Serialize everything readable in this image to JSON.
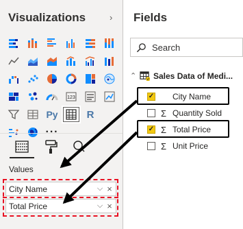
{
  "visualizations": {
    "title": "Visualizations",
    "tiles": [
      [
        "stacked-bar-chart-icon",
        "stacked-column-chart-icon",
        "clustered-bar-chart-icon",
        "clustered-column-chart-icon",
        "100-bar-chart-icon",
        "100-column-chart-icon"
      ],
      [
        "line-chart-icon",
        "area-chart-icon",
        "stacked-area-chart-icon",
        "line-column-chart-icon",
        "line-clustered-column-chart-icon",
        "ribbon-chart-icon"
      ],
      [
        "waterfall-chart-icon",
        "scatter-chart-icon",
        "pie-chart-icon",
        "donut-chart-icon",
        "treemap-icon",
        "map-icon"
      ],
      [
        "filled-map-icon",
        "shape-map-icon",
        "gauge-icon",
        "card-icon",
        "multi-row-card-icon",
        "kpi-icon"
      ],
      [
        "slicer-icon",
        "table-icon",
        "python-visual-icon",
        "matrix-icon",
        "r-visual-icon",
        ""
      ],
      [
        "key-influencers-icon",
        "globe-icon",
        "more-visuals-icon",
        "",
        "",
        ""
      ]
    ],
    "python_label": "Py",
    "r_label": "R",
    "more_label": "···",
    "values_label": "Values",
    "value_wells": [
      {
        "name": "City Name"
      },
      {
        "name": "Total Price"
      }
    ],
    "well_chevron": "⌵",
    "well_remove": "×"
  },
  "fields": {
    "title": "Fields",
    "search_placeholder": "Search",
    "table_name": "Sales Data of Medi...",
    "items": [
      {
        "label": "City Name",
        "checked": true,
        "sigma": false
      },
      {
        "label": "Quantity Sold",
        "checked": false,
        "sigma": true
      },
      {
        "label": "Total Price",
        "checked": true,
        "sigma": true
      },
      {
        "label": "Unit Price",
        "checked": false,
        "sigma": true
      }
    ],
    "sigma_symbol": "Σ"
  },
  "colors": {
    "accent_yellow": "#f2c811",
    "annotation_red": "#e81123",
    "pane_bg": "#f3f2f1"
  }
}
